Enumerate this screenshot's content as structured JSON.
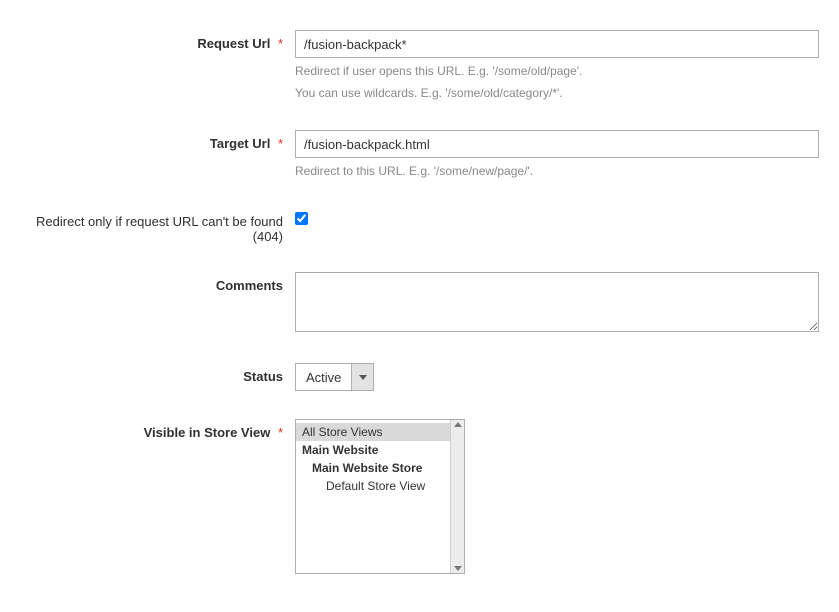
{
  "requestUrl": {
    "label": "Request Url",
    "value": "/fusion-backpack*",
    "hint1": "Redirect if user opens this URL. E.g. '/some/old/page'.",
    "hint2": "You can use wildcards. E.g. '/some/old/category/*'."
  },
  "targetUrl": {
    "label": "Target Url",
    "value": "/fusion-backpack.html",
    "hint": "Redirect to this URL. E.g. '/some/new/page/'."
  },
  "redirect404": {
    "label": "Redirect only if request URL can't be found (404)"
  },
  "comments": {
    "label": "Comments",
    "value": ""
  },
  "status": {
    "label": "Status",
    "value": "Active"
  },
  "storeView": {
    "label": "Visible in Store View",
    "options": {
      "all": "All Store Views",
      "website": "Main Website",
      "store": "Main Website Store",
      "view": "Default Store View"
    }
  }
}
